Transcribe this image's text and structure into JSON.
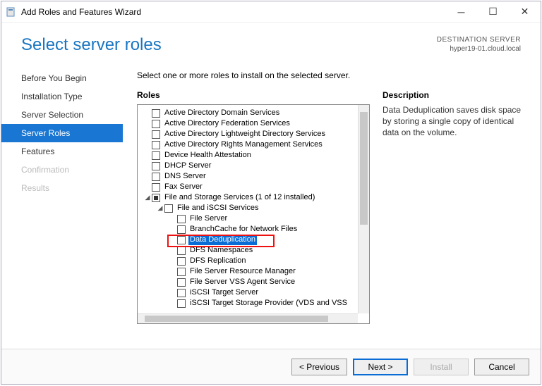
{
  "window": {
    "title": "Add Roles and Features Wizard"
  },
  "header": {
    "page_title": "Select server roles",
    "dest_label": "DESTINATION SERVER",
    "dest_value": "hyper19-01.cloud.local"
  },
  "nav": {
    "items": [
      {
        "label": "Before You Begin",
        "state": "normal"
      },
      {
        "label": "Installation Type",
        "state": "normal"
      },
      {
        "label": "Server Selection",
        "state": "normal"
      },
      {
        "label": "Server Roles",
        "state": "active"
      },
      {
        "label": "Features",
        "state": "normal"
      },
      {
        "label": "Confirmation",
        "state": "disabled"
      },
      {
        "label": "Results",
        "state": "disabled"
      }
    ]
  },
  "content": {
    "instruction": "Select one or more roles to install on the selected server.",
    "roles_heading": "Roles",
    "desc_heading": "Description",
    "description": "Data Deduplication saves disk space by storing a single copy of identical data on the volume.",
    "tree": [
      {
        "indent": 0,
        "arrow": "",
        "check": "empty",
        "label": "Active Directory Domain Services"
      },
      {
        "indent": 0,
        "arrow": "",
        "check": "empty",
        "label": "Active Directory Federation Services"
      },
      {
        "indent": 0,
        "arrow": "",
        "check": "empty",
        "label": "Active Directory Lightweight Directory Services"
      },
      {
        "indent": 0,
        "arrow": "",
        "check": "empty",
        "label": "Active Directory Rights Management Services"
      },
      {
        "indent": 0,
        "arrow": "",
        "check": "empty",
        "label": "Device Health Attestation"
      },
      {
        "indent": 0,
        "arrow": "",
        "check": "empty",
        "label": "DHCP Server"
      },
      {
        "indent": 0,
        "arrow": "",
        "check": "empty",
        "label": "DNS Server"
      },
      {
        "indent": 0,
        "arrow": "",
        "check": "empty",
        "label": "Fax Server"
      },
      {
        "indent": 0,
        "arrow": "down",
        "check": "filled",
        "label": "File and Storage Services (1 of 12 installed)"
      },
      {
        "indent": 1,
        "arrow": "down",
        "check": "empty",
        "label": "File and iSCSI Services"
      },
      {
        "indent": 2,
        "arrow": "",
        "check": "empty",
        "label": "File Server"
      },
      {
        "indent": 2,
        "arrow": "",
        "check": "empty",
        "label": "BranchCache for Network Files"
      },
      {
        "indent": 2,
        "arrow": "",
        "check": "empty",
        "label": "Data Deduplication",
        "selected": true
      },
      {
        "indent": 2,
        "arrow": "",
        "check": "empty",
        "label": "DFS Namespaces"
      },
      {
        "indent": 2,
        "arrow": "",
        "check": "empty",
        "label": "DFS Replication"
      },
      {
        "indent": 2,
        "arrow": "",
        "check": "empty",
        "label": "File Server Resource Manager"
      },
      {
        "indent": 2,
        "arrow": "",
        "check": "empty",
        "label": "File Server VSS Agent Service"
      },
      {
        "indent": 2,
        "arrow": "",
        "check": "empty",
        "label": "iSCSI Target Server"
      },
      {
        "indent": 2,
        "arrow": "",
        "check": "empty",
        "label": "iSCSI Target Storage Provider (VDS and VSS"
      }
    ]
  },
  "footer": {
    "previous": "< Previous",
    "next": "Next >",
    "install": "Install",
    "cancel": "Cancel"
  }
}
